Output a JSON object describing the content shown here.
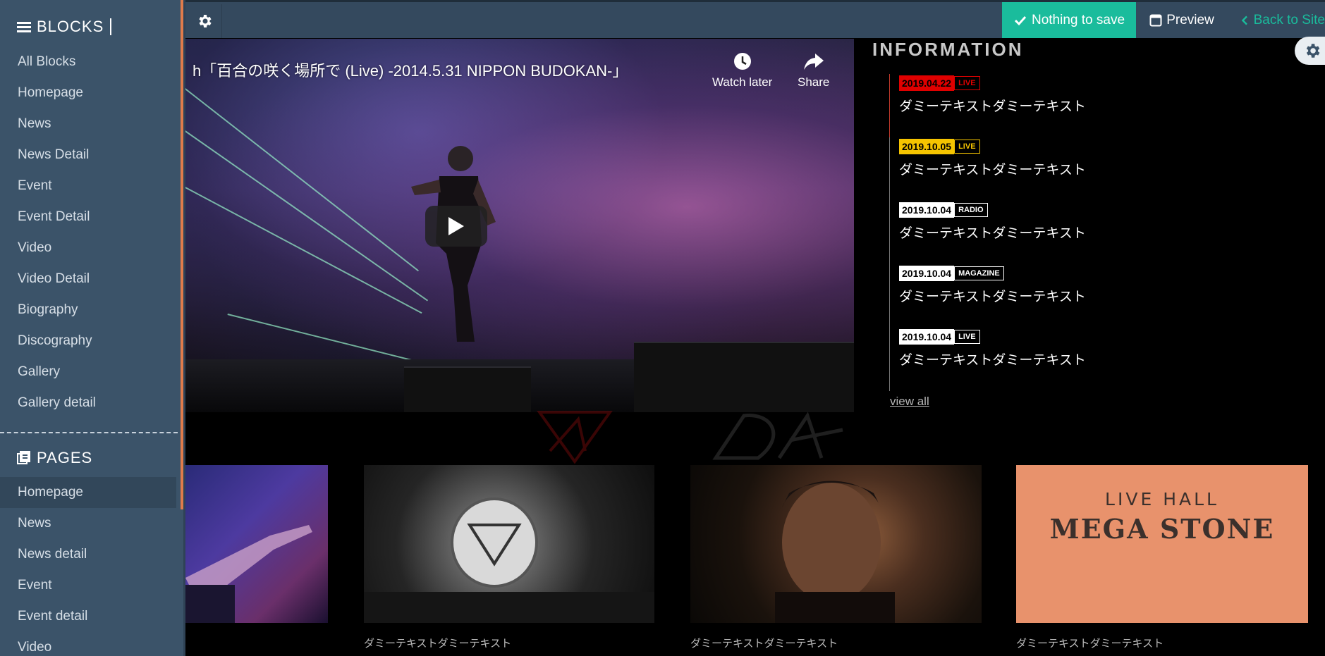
{
  "toolbar": {
    "save_label": "Nothing to save",
    "preview_label": "Preview",
    "back_label": "Back to Site"
  },
  "sidebar": {
    "blocks_heading": "BLOCKS",
    "blocks": [
      "All Blocks",
      "Homepage",
      "News",
      "News Detail",
      "Event",
      "Event Detail",
      "Video",
      "Video Detail",
      "Biography",
      "Discography",
      "Gallery",
      "Gallery detail"
    ],
    "pages_heading": "PAGES",
    "pages": [
      "Homepage",
      "News",
      "News detail",
      "Event",
      "Event detail",
      "Video"
    ],
    "active_page": "Homepage"
  },
  "video": {
    "title": "h「百合の咲く場所で (Live) -2014.5.31 NIPPON BUDOKAN-」",
    "watch_later": "Watch later",
    "share": "Share"
  },
  "information": {
    "title": "INFORMATION",
    "items": [
      {
        "date": "2019.04.22",
        "category": "LIVE",
        "text": "ダミーテキストダミーテキスト",
        "date_bg": "#e00000",
        "date_fg": "#000000",
        "cat_color": "#e00000"
      },
      {
        "date": "2019.10.05",
        "category": "LIVE",
        "text": "ダミーテキストダミーテキスト",
        "date_bg": "#f5c400",
        "date_fg": "#000000",
        "cat_color": "#f5c400"
      },
      {
        "date": "2019.10.04",
        "category": "RADIO",
        "text": "ダミーテキストダミーテキスト",
        "date_bg": "#ffffff",
        "date_fg": "#000000",
        "cat_color": "#ffffff"
      },
      {
        "date": "2019.10.04",
        "category": "MAGAZINE",
        "text": "ダミーテキストダミーテキスト",
        "date_bg": "#ffffff",
        "date_fg": "#000000",
        "cat_color": "#ffffff"
      },
      {
        "date": "2019.10.04",
        "category": "LIVE",
        "text": "ダミーテキストダミーテキスト",
        "date_bg": "#ffffff",
        "date_fg": "#000000",
        "cat_color": "#ffffff"
      }
    ],
    "view_all": "view all"
  },
  "gallery": {
    "captions": [
      "ダミーテキストダミーテキスト",
      "ダミーテキストダミーテキスト",
      "ダミーテキストダミーテキスト"
    ],
    "live_hall_top": "LIVE HALL",
    "live_hall_main": "MEGA STONE"
  },
  "colors": {
    "topbar": "#34495e",
    "sidebar": "#3b5369",
    "accent_green": "#1abc9c",
    "sidebar_accent": "#e07b4b",
    "live_red": "#e00000",
    "live_yellow": "#f5c400"
  }
}
